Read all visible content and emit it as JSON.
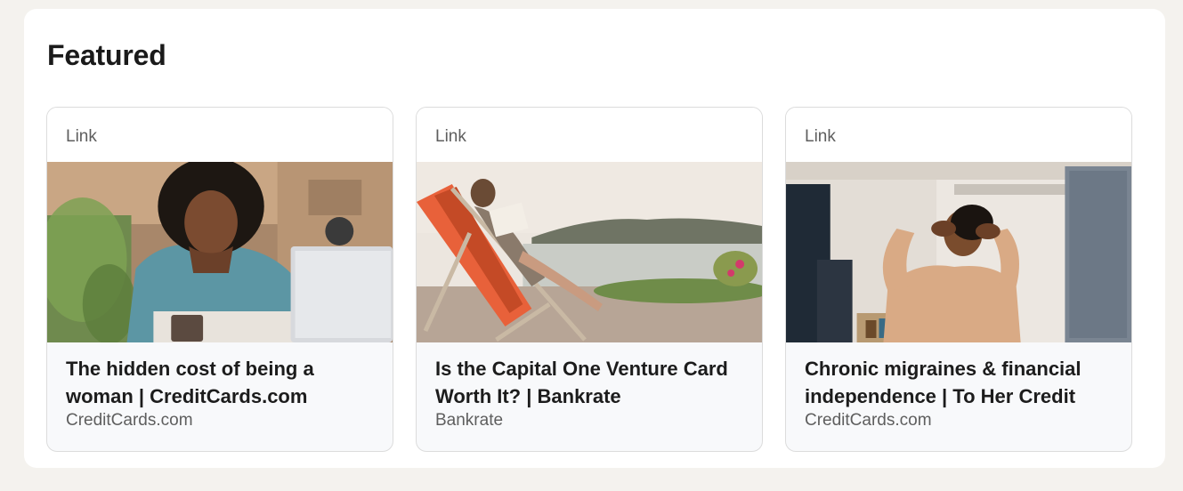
{
  "section": {
    "title": "Featured"
  },
  "cards": [
    {
      "type_label": "Link",
      "image_icon": "photo-woman-laptop",
      "title": "The hidden cost of being a woman | CreditCards.com",
      "source": "CreditCards.com"
    },
    {
      "type_label": "Link",
      "image_icon": "photo-deckchair-reading",
      "title": "Is the Capital One Venture Card Worth It? | Bankrate",
      "source": "Bankrate"
    },
    {
      "type_label": "Link",
      "image_icon": "photo-woman-headache",
      "title": "Chronic migraines & financial independence | To Her Credit",
      "source": "CreditCards.com"
    }
  ]
}
